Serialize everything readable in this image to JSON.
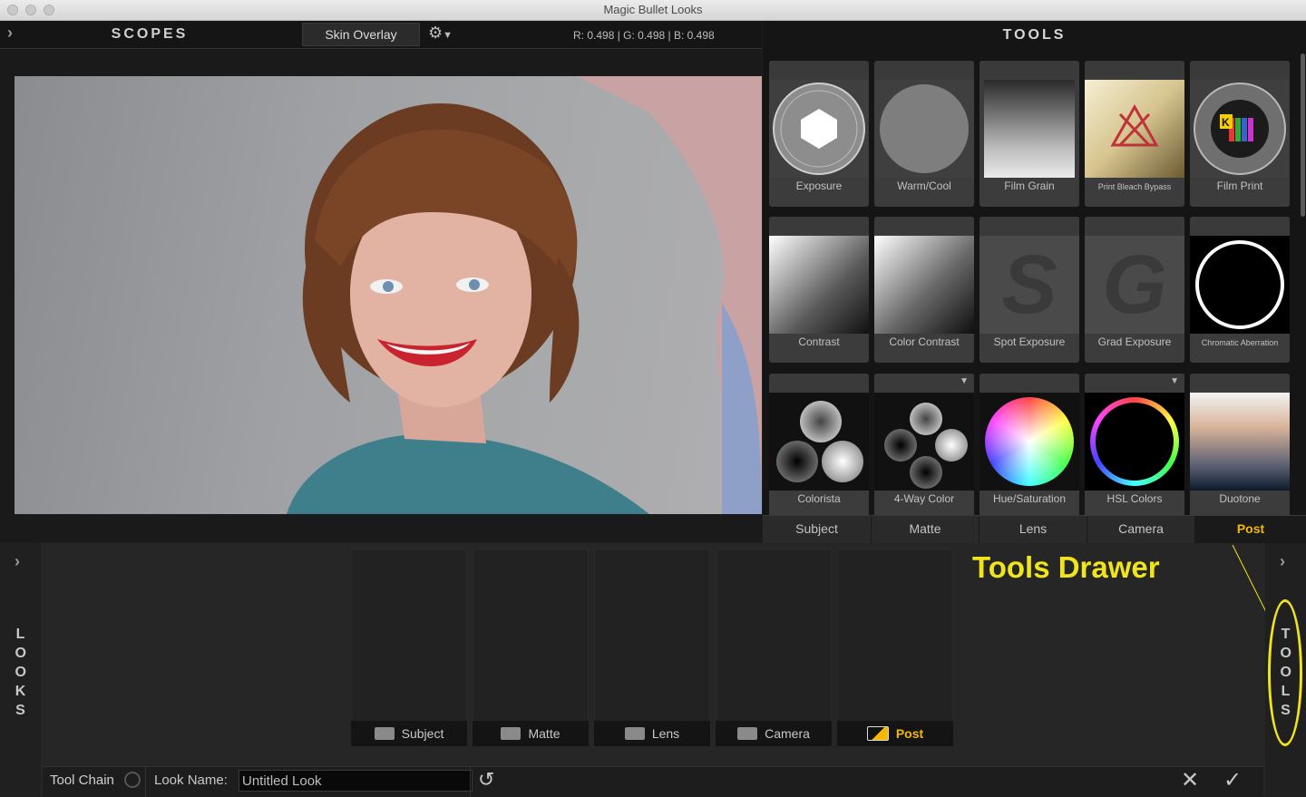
{
  "window": {
    "title": "Magic Bullet Looks"
  },
  "scopes": {
    "title": "SCOPES",
    "overlay_button": "Skin Overlay",
    "readout": "R: 0.498 | G: 0.498 | B: 0.498"
  },
  "tools": {
    "title": "TOOLS",
    "rows": [
      [
        {
          "label": "Exposure"
        },
        {
          "label": "Warm/Cool"
        },
        {
          "label": "Film Grain"
        },
        {
          "label": "Print Bleach Bypass"
        },
        {
          "label": "Film Print"
        }
      ],
      [
        {
          "label": "Contrast"
        },
        {
          "label": "Color Contrast"
        },
        {
          "label": "Spot Exposure"
        },
        {
          "label": "Grad Exposure"
        },
        {
          "label": "Chromatic Aberration"
        }
      ],
      [
        {
          "label": "Colorista"
        },
        {
          "label": "4-Way Color"
        },
        {
          "label": "Hue/Saturation"
        },
        {
          "label": "HSL Colors"
        },
        {
          "label": "Duotone"
        }
      ]
    ],
    "tabs": [
      "Subject",
      "Matte",
      "Lens",
      "Camera",
      "Post"
    ],
    "active_tab": "Post",
    "thumb_letters": {
      "spot": "S",
      "grad": "G",
      "film_print": "K"
    }
  },
  "drawer": {
    "looks_label": "LOOKS",
    "tools_label": "TOOLS",
    "slots": [
      "Subject",
      "Matte",
      "Lens",
      "Camera",
      "Post"
    ],
    "annotation": "Tools Drawer"
  },
  "footer": {
    "tool_chain": "Tool Chain",
    "look_name_label": "Look Name:",
    "look_name_value": "Untitled Look"
  },
  "colors": {
    "accent": "#f5b800",
    "annotation": "#f0e41c"
  }
}
